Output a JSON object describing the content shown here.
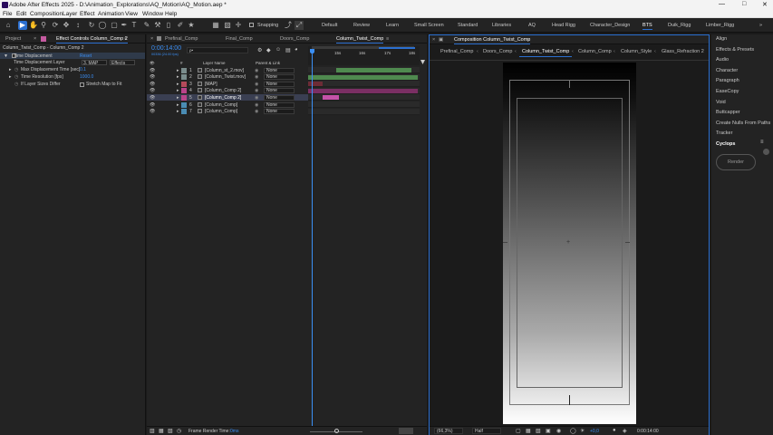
{
  "app": {
    "title": "Adobe After Effects 2025 - D:\\Animation_Explorations\\AQ_Motion\\AQ_Motion.aep *"
  },
  "menu": [
    "File",
    "Edit",
    "Composition",
    "Layer",
    "Effect",
    "Animation",
    "View",
    "Window",
    "Help"
  ],
  "toolbar": {
    "snapping": "Snapping",
    "workspaces": [
      "Default",
      "Review",
      "Learn",
      "Small Screen",
      "Standard",
      "Libraries",
      "AQ",
      "Head Rigg",
      "Character_Design",
      "BTS",
      "Duik_Rigg",
      "Limber_Rigg"
    ],
    "active_workspace": "BTS"
  },
  "left": {
    "tab_project": "Project",
    "tab_effect": "Effect Controls Column_Comp 2",
    "breadcrumb": "Column_Twist_Comp - Column_Comp 2",
    "effect_name": "Time Displacement",
    "reset": "Reset",
    "rows": [
      {
        "label": "Time Displacement Layer",
        "value": "3. MAP",
        "value2": "Effects"
      },
      {
        "label": "Max Displacement Time [sec]",
        "value": "0.1"
      },
      {
        "label": "Time Resolution [fps]",
        "value": "1000.0"
      },
      {
        "label": "If Layer Sizes Differ",
        "value": "Stretch Map to Fit"
      }
    ]
  },
  "timeline": {
    "tabs": [
      "Prefinal_Comp",
      "Final_Comp",
      "Doors_Comp",
      "Column_Twist_Comp"
    ],
    "active_tab": "Column_Twist_Comp",
    "timecode": "0:00:14:00",
    "frames": "00336 (24.00 fps)",
    "search_placeholder": "ρ•",
    "col_layer": "Layer Name",
    "col_parent": "Parent & Link",
    "col_num": "#",
    "ruler": [
      "15s",
      "16s",
      "17s",
      "18s"
    ],
    "layers": [
      {
        "num": "1",
        "name": "[Column_st_2.mov]",
        "parent": "None",
        "color": "#7a8c8c"
      },
      {
        "num": "2",
        "name": "[Column_Twist.mov]",
        "parent": "None",
        "color": "#7a8c8c"
      },
      {
        "num": "3",
        "name": "[MAP]",
        "parent": "None",
        "color": "#b54a5a"
      },
      {
        "num": "4",
        "name": "[Column_Comp 2]",
        "parent": "None",
        "color": "#b8448a"
      },
      {
        "num": "5",
        "name": "[Column_Comp 2]",
        "parent": "None",
        "color": "#b8448a"
      },
      {
        "num": "6",
        "name": "[Column_Comp]",
        "parent": "None",
        "color": "#4a8cb3"
      },
      {
        "num": "7",
        "name": "[Column_Comp]",
        "parent": "None",
        "color": "#4a8cb3"
      }
    ],
    "render_label": "Frame Render Time:",
    "render_value": "0ms"
  },
  "comp": {
    "header": "Composition Column_Twist_Comp",
    "tabs": [
      "Prefinal_Comp",
      "Doors_Comp",
      "Column_Twist_Comp",
      "Column_Comp",
      "Column_Style",
      "Glass_Refraction 2"
    ],
    "active_tab": "Column_Twist_Comp",
    "zoom": "(66,3%)",
    "resolution": "Half",
    "exposure": "+0,0",
    "timecode": "0:00:14:00"
  },
  "right": {
    "items": [
      "Align",
      "Effects & Presets",
      "Audio",
      "Character",
      "Paragraph",
      "EaseCopy",
      "Void",
      "Buttcapper",
      "Create Nulls From Paths",
      "Tracker",
      "Cyclops"
    ],
    "render": "Render"
  }
}
